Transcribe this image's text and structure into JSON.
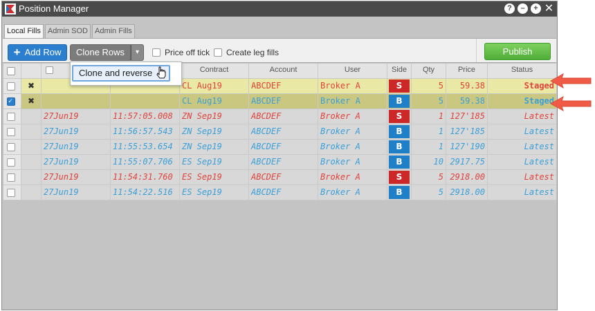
{
  "window": {
    "title": "Position Manager",
    "controls": [
      "?",
      "–",
      "+",
      "✕"
    ]
  },
  "tabs": [
    {
      "label": "Local Fills",
      "active": true
    },
    {
      "label": "Admin SOD",
      "active": false
    },
    {
      "label": "Admin Fills",
      "active": false
    }
  ],
  "toolbar": {
    "add_row_label": "Add Row",
    "clone_rows_label": "Clone Rows",
    "clone_caret": "▾",
    "price_off_tick_label": "Price off tick",
    "create_leg_fills_label": "Create leg fills",
    "publish_label": "Publish"
  },
  "dropdown": {
    "items": [
      "Clone and reverse"
    ]
  },
  "table": {
    "headers": [
      "",
      "",
      "",
      "Contract",
      "Account",
      "User",
      "Side",
      "Qty",
      "Price",
      "Status"
    ],
    "rows": [
      {
        "checked": false,
        "x": "✖",
        "date": "",
        "time": "",
        "contract": "CL Aug19",
        "account": "ABCDEF",
        "user": "Broker A",
        "side": "S",
        "qty": "5",
        "price": "59.38",
        "status": "Staged",
        "kind": "staged1"
      },
      {
        "checked": true,
        "x": "✖",
        "date": "",
        "time": "",
        "contract": "CL Aug19",
        "account": "ABCDEF",
        "user": "Broker A",
        "side": "B",
        "qty": "5",
        "price": "59.38",
        "status": "Staged",
        "kind": "staged2"
      },
      {
        "checked": false,
        "x": "",
        "date": "27Jun19",
        "time": "11:57:05.008",
        "contract": "ZN Sep19",
        "account": "ABCDEF",
        "user": "Broker A",
        "side": "S",
        "qty": "1",
        "price": "127'185",
        "status": "Latest",
        "kind": "latest"
      },
      {
        "checked": false,
        "x": "",
        "date": "27Jun19",
        "time": "11:56:57.543",
        "contract": "ZN Sep19",
        "account": "ABCDEF",
        "user": "Broker A",
        "side": "B",
        "qty": "1",
        "price": "127'185",
        "status": "Latest",
        "kind": "latest"
      },
      {
        "checked": false,
        "x": "",
        "date": "27Jun19",
        "time": "11:55:53.654",
        "contract": "ZN Sep19",
        "account": "ABCDEF",
        "user": "Broker A",
        "side": "B",
        "qty": "1",
        "price": "127'190",
        "status": "Latest",
        "kind": "latest"
      },
      {
        "checked": false,
        "x": "",
        "date": "27Jun19",
        "time": "11:55:07.706",
        "contract": "ES Sep19",
        "account": "ABCDEF",
        "user": "Broker A",
        "side": "B",
        "qty": "10",
        "price": "2917.75",
        "status": "Latest",
        "kind": "latest"
      },
      {
        "checked": false,
        "x": "",
        "date": "27Jun19",
        "time": "11:54:31.760",
        "contract": "ES Sep19",
        "account": "ABCDEF",
        "user": "Broker A",
        "side": "S",
        "qty": "5",
        "price": "2918.00",
        "status": "Latest",
        "kind": "latest"
      },
      {
        "checked": false,
        "x": "",
        "date": "27Jun19",
        "time": "11:54:22.516",
        "contract": "ES Sep19",
        "account": "ABCDEF",
        "user": "Broker A",
        "side": "B",
        "qty": "5",
        "price": "2918.00",
        "status": "Latest",
        "kind": "latest"
      }
    ]
  },
  "colors": {
    "sell_text": "#e0423a",
    "buy_text": "#3a9fd8",
    "sell_badge": "#cc2828",
    "buy_badge": "#1f80c8",
    "staged1_bg": "#e9e8a5",
    "staged2_bg": "#c9c780",
    "latest_bg": "#d8d8d8",
    "arrow": "#ef5b46"
  }
}
